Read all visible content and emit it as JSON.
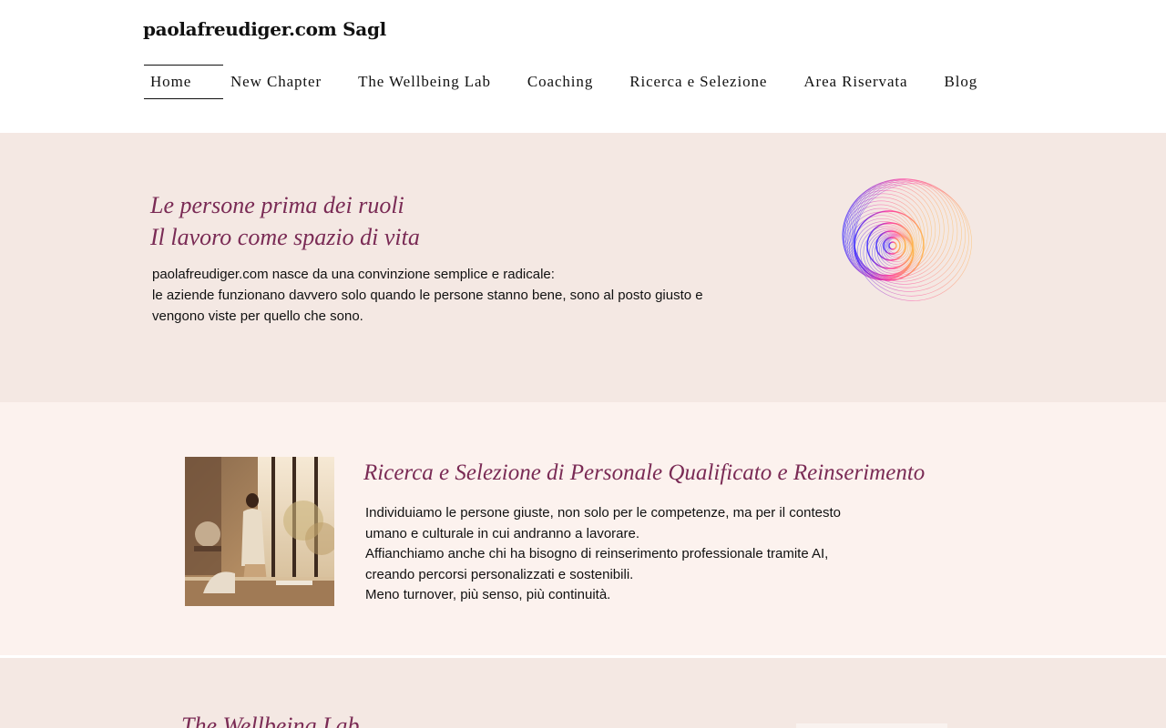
{
  "brand": "paolafreudiger.com Sagl",
  "nav": [
    {
      "label": "Home",
      "active": true
    },
    {
      "label": "New Chapter"
    },
    {
      "label": "The Wellbeing Lab"
    },
    {
      "label": "Coaching"
    },
    {
      "label": "Ricerca e Selezione"
    },
    {
      "label": "Area Riservata"
    },
    {
      "label": "Blog"
    }
  ],
  "hero": {
    "title_line1": "Le persone prima dei ruoli",
    "title_line2": "Il lavoro come spazio di vita",
    "body_line1": "paolafreudiger.com nasce da una convinzione semplice e radicale:",
    "body_line2": "le aziende funzionano davvero solo quando le persone stanno bene, sono al posto giusto e",
    "body_line3": "vengono viste per quello che sono."
  },
  "services": {
    "title": "Ricerca e Selezione di Personale Qualificato e Reinserimento",
    "lines": [
      "Individuiamo le persone giuste, non solo per le competenze, ma per il contesto",
      "umano e culturale in cui andranno a lavorare.",
      "Affianchiamo anche chi ha bisogno di reinserimento professionale tramite AI,",
      "creando percorsi personalizzati e sostenibili.",
      "Meno turnover, più senso, più continuità."
    ]
  },
  "wellbeing": {
    "title": "The Wellbeing Lab"
  },
  "colors": {
    "accent": "#7a2b55",
    "hero_bg": "#f4e8e3",
    "services_bg": "#fcf2ee",
    "spiral_gradient": [
      "#3b2bff",
      "#ff2d9a",
      "#ffb347"
    ]
  }
}
